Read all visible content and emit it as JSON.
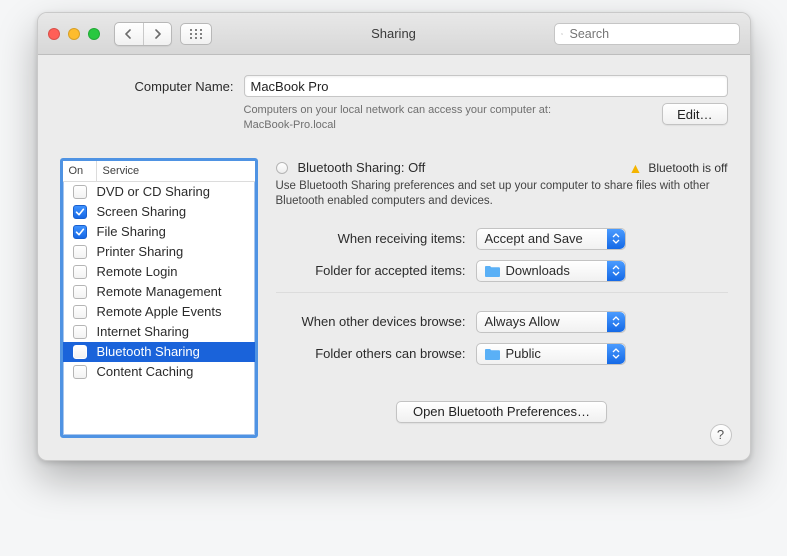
{
  "window": {
    "title": "Sharing"
  },
  "search": {
    "placeholder": "Search"
  },
  "computer_name": {
    "label": "Computer Name:",
    "value": "MacBook Pro",
    "description_1": "Computers on your local network can access your computer at:",
    "hostname": "MacBook-Pro.local",
    "edit_label": "Edit…"
  },
  "services": {
    "col_on": "On",
    "col_service": "Service",
    "items": [
      {
        "label": "DVD or CD Sharing",
        "checked": false,
        "selected": false
      },
      {
        "label": "Screen Sharing",
        "checked": true,
        "selected": false
      },
      {
        "label": "File Sharing",
        "checked": true,
        "selected": false
      },
      {
        "label": "Printer Sharing",
        "checked": false,
        "selected": false
      },
      {
        "label": "Remote Login",
        "checked": false,
        "selected": false
      },
      {
        "label": "Remote Management",
        "checked": false,
        "selected": false
      },
      {
        "label": "Remote Apple Events",
        "checked": false,
        "selected": false
      },
      {
        "label": "Internet Sharing",
        "checked": false,
        "selected": false
      },
      {
        "label": "Bluetooth Sharing",
        "checked": false,
        "selected": true
      },
      {
        "label": "Content Caching",
        "checked": false,
        "selected": false
      }
    ]
  },
  "detail": {
    "title": "Bluetooth Sharing: Off",
    "warning": "Bluetooth is off",
    "description": "Use Bluetooth Sharing preferences and set up your computer to share files with other Bluetooth enabled computers and devices.",
    "recv_label": "When receiving items:",
    "recv_value": "Accept and Save",
    "recv_folder_label": "Folder for accepted items:",
    "recv_folder_value": "Downloads",
    "browse_label": "When other devices browse:",
    "browse_value": "Always Allow",
    "browse_folder_label": "Folder others can browse:",
    "browse_folder_value": "Public",
    "open_pref_label": "Open Bluetooth Preferences…"
  },
  "help": {
    "label": "?"
  }
}
